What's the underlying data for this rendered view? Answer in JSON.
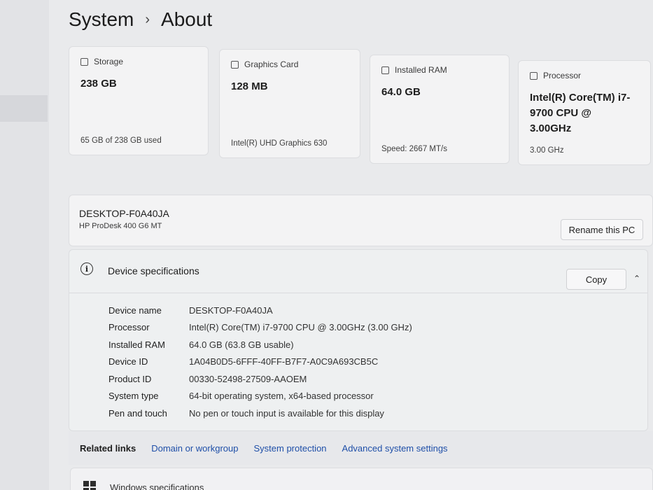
{
  "breadcrumb": {
    "parent": "System",
    "separator": "›",
    "current": "About"
  },
  "cards": [
    {
      "label": "Storage",
      "value": "238 GB",
      "sub": "65 GB of 238 GB used",
      "icon": "storage-icon"
    },
    {
      "label": "Graphics Card",
      "value": "128 MB",
      "sub": "Intel(R) UHD Graphics 630",
      "icon": "graphics-card-icon"
    },
    {
      "label": "Installed RAM",
      "value": "64.0 GB",
      "sub": "Speed: 2667 MT/s",
      "icon": "ram-icon"
    },
    {
      "label": "Processor",
      "value": "Intel(R) Core(TM) i7-9700 CPU @ 3.00GHz",
      "sub": "3.00 GHz",
      "icon": "processor-icon"
    }
  ],
  "device": {
    "name": "DESKTOP-F0A40JA",
    "model": "HP ProDesk 400 G6 MT",
    "rename_label": "Rename this PC"
  },
  "specs": {
    "title": "Device specifications",
    "copy_label": "Copy",
    "chevron": "⌃",
    "rows": [
      {
        "k": "Device name",
        "v": "DESKTOP-F0A40JA"
      },
      {
        "k": "Processor",
        "v": "Intel(R) Core(TM) i7-9700 CPU @ 3.00GHz (3.00 GHz)"
      },
      {
        "k": "Installed RAM",
        "v": "64.0 GB (63.8 GB usable)"
      },
      {
        "k": "Device ID",
        "v": "1A04B0D5-6FFF-40FF-B7F7-A0C9A693CB5C"
      },
      {
        "k": "Product ID",
        "v": "00330-52498-27509-AAOEM"
      },
      {
        "k": "System type",
        "v": "64-bit operating system, x64-based processor"
      },
      {
        "k": "Pen and touch",
        "v": "No pen or touch input is available for this display"
      }
    ]
  },
  "related": {
    "label": "Related links",
    "links": [
      "Domain or workgroup",
      "System protection",
      "Advanced system settings"
    ]
  },
  "bottom": {
    "text": "Windows specifications"
  }
}
